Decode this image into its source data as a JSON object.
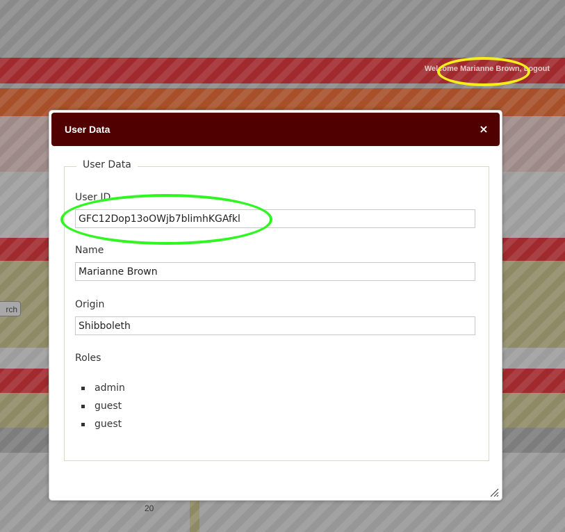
{
  "header": {
    "welcome_prefix": "Welcome",
    "user_name": "Marianne Brown",
    "logout_label": "Logout"
  },
  "background": {
    "search_button_label": "rch",
    "table_value": "20"
  },
  "dialog": {
    "title": "User Data",
    "close_icon": "×",
    "fieldset_legend": "User Data",
    "fields": {
      "user_id": {
        "label": "User ID",
        "value": "GFC12Dop13oOWjb7blimhKGAfkl"
      },
      "name": {
        "label": "Name",
        "value": "Marianne Brown"
      },
      "origin": {
        "label": "Origin",
        "value": "Shibboleth"
      }
    },
    "roles_label": "Roles",
    "roles": [
      "admin",
      "guest",
      "guest"
    ]
  },
  "colors": {
    "header_bar": "#500000",
    "highlight_yellow": "#f4ee1c",
    "highlight_green": "#2ff520"
  }
}
